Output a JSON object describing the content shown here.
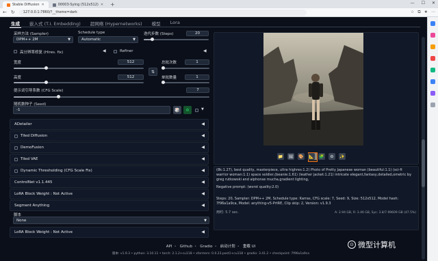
{
  "browser": {
    "tabs": [
      {
        "title": "Stable Diffusion"
      },
      {
        "title": "00003-Sying (512x512)"
      }
    ],
    "new_tab": "+",
    "url": "127.0.0.1:7860/?__theme=dark",
    "win_min": "—",
    "win_max": "☐",
    "win_close": "✕"
  },
  "main_tabs": [
    "生成",
    "嵌入式 (T.I. Embedding)",
    "超网络 (Hypernetworks)",
    "模型",
    "Lora"
  ],
  "params": {
    "sampler_label": "采样方法 (Sampler)",
    "sampler_value": "DPM++ 2M",
    "schedule_label": "Schedule type",
    "schedule_value": "Automatic",
    "steps_label": "迭代步数 (Steps)",
    "steps_value": "20",
    "steps_frac": 0.13,
    "hires_label": "高分辨率修复 (Hires. fix)",
    "refiner_label": "Refiner",
    "width_label": "宽度",
    "width_value": "512",
    "width_frac": 0.25,
    "height_label": "高度",
    "height_value": "512",
    "height_frac": 0.25,
    "batch_count_label": "总批次数",
    "batch_count_value": "1",
    "batch_count_frac": 0.02,
    "batch_size_label": "单批数量",
    "batch_size_value": "1",
    "batch_size_frac": 0.02,
    "swap_icon": "⇅",
    "cfg_label": "提示词引导系数 (CFG Scale)",
    "cfg_value": "7",
    "cfg_frac": 0.23,
    "seed_label": "随机数种子 (Seed)",
    "seed_value": "-1",
    "dice_icon": "🎲",
    "recycle_icon": "♻"
  },
  "accordions": [
    "ADetailer",
    "Tiled Diffusion",
    "DemoFusion",
    "Tiled VAE",
    "Dynamic Thresholding (CFG Scale Fix)",
    "ControlNet v1.1.445",
    "LoRA Block Weight : Not Active",
    "Segment Anything"
  ],
  "script_label": "脚本",
  "script_value": "None",
  "last_accordion": "LoRA Block Weight : Not Active",
  "arrow": "◀",
  "output": {
    "tools": [
      "📁",
      "🖼",
      "🎨",
      "📐",
      "🧩",
      "⚙",
      "✨"
    ],
    "prompt": "(8k:1.27), best quality, masterpiece, ultra highres:1.2) Photo of Pretty Japanese woman (beautiful:1.1) (sci-fi warrior woman:1.1) space soldier,(beanie:1.61) (leather jacket:1.21) intricate elegant,fantasy,detailed,ometric by greg rutkowski and alphonse mucha,gradient lighting,",
    "negative": "Negative prompt: (worst quality:2.0)",
    "params": "Steps: 20, Sampler: DPM++ 2M, Schedule type: Karras, CFG scale: 7, Seed: 9, Size: 512x512, Model hash: 7f96a1a9ca, Model: anything-v5-PrtRE, Clip skip: 2, Version: v1.9.3",
    "time": "用时: 5.7 sec.",
    "vram": "A: 2.94 GB, R: 3.46 GB, Sys: 3.8/7.99609 GB (47.5%)"
  },
  "footer": {
    "links": [
      "API",
      "Github",
      "Gradio",
      "启动计划",
      "重载 UI"
    ],
    "sep": "•",
    "versions": "版本: v1.9.3  •  python: 3.10.11  •  torch: 2.1.2+cu118  •  xformers: 0.0.23.post1+cu118  •  gradio: 3.41.2  •  checkpoint: 7f96a1a9ca"
  },
  "watermark": "微型计算机",
  "watermark_icon": "⊙",
  "colors": {
    "accent": "#f97316",
    "bg": "#0b0f19",
    "panel": "#111827"
  }
}
